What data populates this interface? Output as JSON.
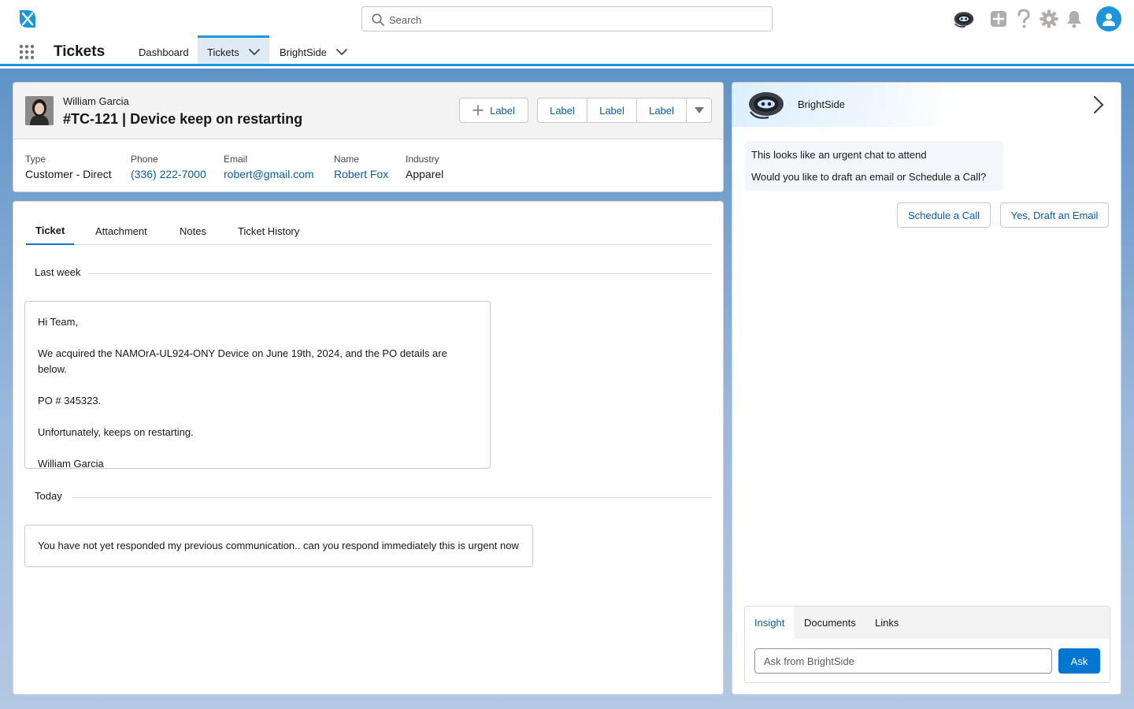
{
  "header": {
    "search_placeholder": "Search",
    "icons": [
      "brightside-bot-icon",
      "plus-icon",
      "help-icon",
      "settings-gear-icon",
      "notification-bell-icon",
      "user-avatar-icon"
    ]
  },
  "app_nav": {
    "app_name": "Tickets",
    "items": [
      {
        "label": "Dashboard",
        "active": false,
        "has_menu": false
      },
      {
        "label": "Tickets",
        "active": true,
        "has_menu": true
      },
      {
        "label": "BrightSide",
        "active": false,
        "has_menu": true
      }
    ]
  },
  "record": {
    "contact_name": "William Garcia",
    "title": "#TC-121 | Device keep on restarting",
    "add_label_button": "Label",
    "button_group": [
      "Label",
      "Label",
      "Label"
    ],
    "fields": [
      {
        "label": "Type",
        "value": "Customer - Direct",
        "link": false
      },
      {
        "label": "Phone",
        "value": "(336) 222-7000",
        "link": true
      },
      {
        "label": "Email",
        "value": "robert@gmail.com",
        "link": true
      },
      {
        "label": "Name",
        "value": "Robert Fox",
        "link": true
      },
      {
        "label": "Industry",
        "value": "Apparel",
        "link": false
      }
    ]
  },
  "ticket": {
    "tabs": [
      "Ticket",
      "Attachment",
      "Notes",
      "Ticket History"
    ],
    "active_tab": "Ticket",
    "groups": [
      {
        "label": "Last week",
        "message": [
          "Hi Team,",
          "We acquired the NAMOrA-UL924-ONY Device on June 19th, 2024, and the PO details are below.",
          "PO # 345323.",
          "Unfortunately, keeps on restarting.",
          "William Garcia"
        ]
      },
      {
        "label": "Today",
        "message": [
          "You have not yet responded my previous communication.. can you respond immediately this is urgent now"
        ]
      }
    ]
  },
  "assistant": {
    "name": "BrightSide",
    "bubble": [
      "This looks like an urgent chat to attend",
      "Would you like to draft an email or Schedule a Call?"
    ],
    "actions": [
      "Schedule a Call",
      "Yes, Draft an Email"
    ],
    "bottom_tabs": [
      "Insight",
      "Documents",
      "Links"
    ],
    "active_bottom_tab": "Insight",
    "ask_placeholder": "Ask from BrightSide",
    "ask_button": "Ask"
  },
  "colors": {
    "brand_blue": "#0176d3",
    "link_blue": "#0b5cab",
    "nav_accent": "#1b96d9",
    "avatar_bg": "#1b96d9"
  }
}
